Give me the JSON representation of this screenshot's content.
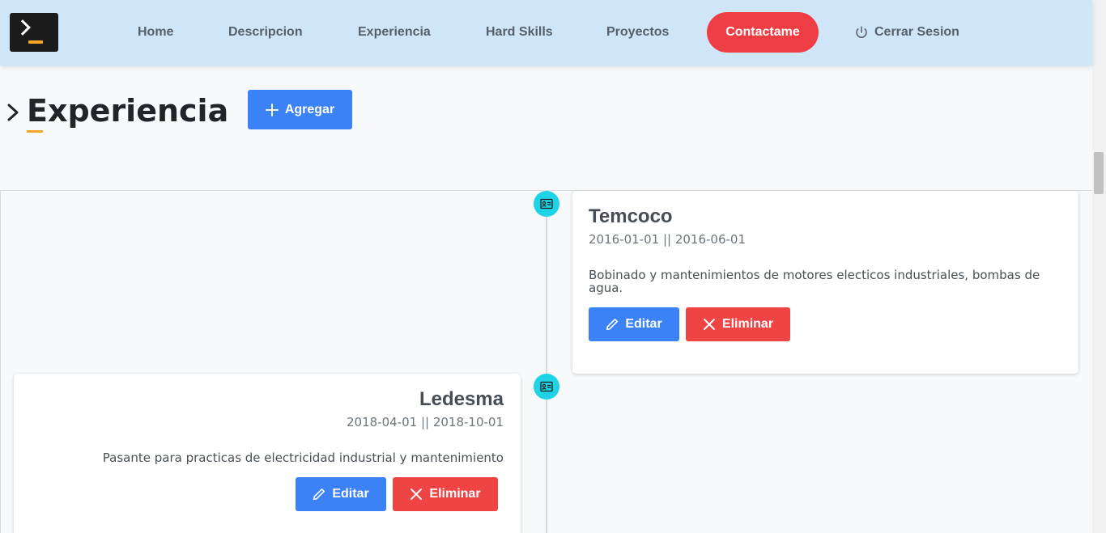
{
  "navbar": {
    "logo_icon": "terminal-icon",
    "items": [
      {
        "label": "Home"
      },
      {
        "label": "Descripcion"
      },
      {
        "label": "Experiencia"
      },
      {
        "label": "Hard Skills"
      },
      {
        "label": "Proyectos"
      }
    ],
    "contact_label": "Contactame",
    "logout_label": "Cerrar Sesion",
    "logout_icon": "power-icon",
    "contact_color": "#ef3e43"
  },
  "header": {
    "title": "Experiencia",
    "add_label": "Agregar"
  },
  "experiences": [
    {
      "company": "Temcoco",
      "dates": "2016-01-01 || 2016-06-01",
      "description": "Bobinado y mantenimientos de motores electicos industriales, bombas de agua.",
      "edit_label": "Editar",
      "delete_label": "Eliminar"
    },
    {
      "company": "Ledesma",
      "dates": "2018-04-01 || 2018-10-01",
      "description": "Pasante para practicas de electricidad industrial y mantenimiento",
      "edit_label": "Editar",
      "delete_label": "Eliminar"
    }
  ],
  "colors": {
    "navbar_bg": "#cfe6f8",
    "primary": "#3b82f6",
    "danger": "#ef4444",
    "marker": "#1fd3e6",
    "accent": "#f5a623"
  }
}
